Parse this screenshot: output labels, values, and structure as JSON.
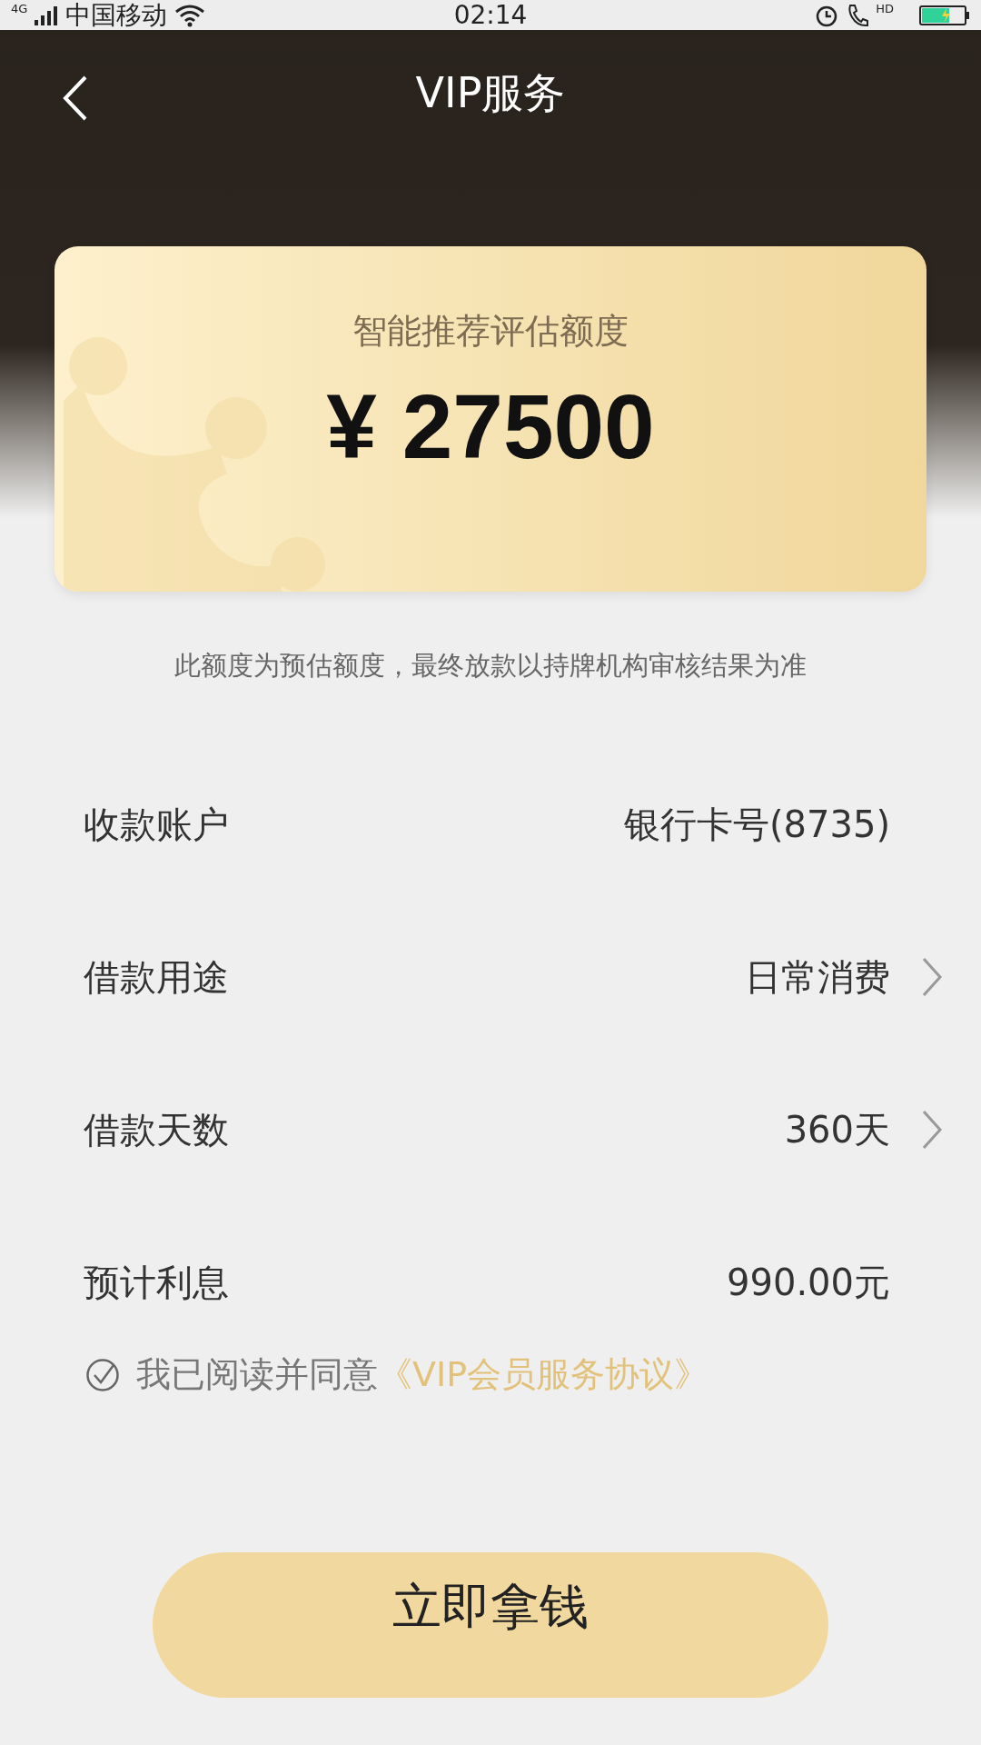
{
  "status_bar": {
    "network": "4G",
    "carrier": "中国移动",
    "time": "02:14",
    "call": "HD"
  },
  "nav": {
    "title": "VIP服务"
  },
  "card": {
    "label": "智能推荐评估额度",
    "amount": "¥ 27500"
  },
  "disclaimer": "此额度为预估额度，最终放款以持牌机构审核结果为准",
  "rows": [
    {
      "kind": "plain",
      "label": "收款账户",
      "value": "银行卡号(8735)"
    },
    {
      "kind": "link",
      "label": "借款用途",
      "value": "日常消费"
    },
    {
      "kind": "link",
      "label": "借款天数",
      "value": "360天"
    },
    {
      "kind": "plain",
      "label": "预计利息",
      "value": "990.00元"
    }
  ],
  "agreement": {
    "checked": true,
    "text": "我已阅读并同意",
    "link": "《VIP会员服务协议》"
  },
  "submit_button": "立即拿钱"
}
